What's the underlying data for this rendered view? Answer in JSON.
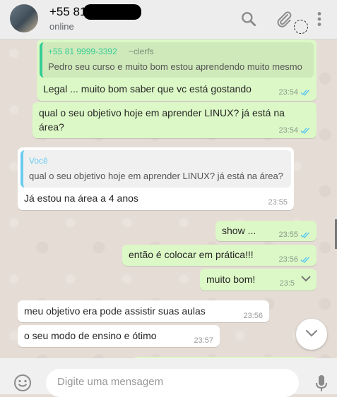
{
  "header": {
    "contact_name": "+55 81",
    "status": "online",
    "icons": [
      "search-icon",
      "attach-icon",
      "menu-icon"
    ]
  },
  "messages": [
    {
      "direction": "out",
      "quote_author": "+55 81 9999-3392",
      "quote_note": "~clerfs",
      "quote_text": "Pedro seu curso e muito bom estou aprendendo muito mesmo",
      "text": "Legal ... muito bom saber que vc está gostando",
      "time": "23:54",
      "status": "read"
    },
    {
      "direction": "out",
      "line1": "qual o seu objetivo hoje em aprender LINUX? já está na",
      "line2": "área?",
      "time": "23:54",
      "status": "read"
    },
    {
      "direction": "in",
      "quote_author": "Você",
      "quote_text": "qual o seu objetivo hoje em aprender LINUX? já está na área?",
      "text": "Já estou na área a 4 anos",
      "time": "23:55"
    },
    {
      "direction": "out",
      "text": "show ...",
      "time": "23:55",
      "status": "read"
    },
    {
      "direction": "out",
      "text": "então é colocar em prática!!!",
      "time": "23:56",
      "status": "read"
    },
    {
      "direction": "out",
      "text": "muito bom!",
      "time": "23:5"
    },
    {
      "direction": "in",
      "text": "meu objetivo era pode assistir suas aulas",
      "time": "23:56"
    },
    {
      "direction": "in",
      "text": "o seu modo de ensino e ótimo",
      "time": "23:57"
    }
  ],
  "composer": {
    "placeholder": "Digite uma mensagem"
  },
  "colors": {
    "outgoing_bubble": "#dcf8c6",
    "incoming_bubble": "#ffffff",
    "read_ticks": "#4fc3f7",
    "chat_background": "#e5ddd5"
  }
}
